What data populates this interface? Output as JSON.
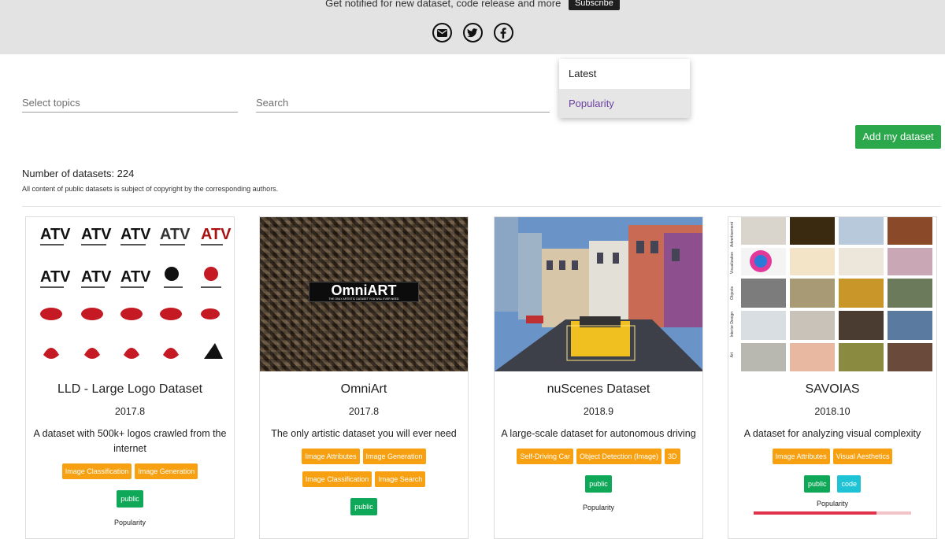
{
  "header": {
    "notify_text": "Get notified for new dataset, code release and more",
    "subscribe_label": "Subscribe",
    "social": [
      {
        "icon": "mail-icon"
      },
      {
        "icon": "twitter-icon"
      },
      {
        "icon": "facebook-icon"
      }
    ]
  },
  "filters": {
    "topics_placeholder": "Select topics",
    "search_placeholder": "Search"
  },
  "sort": {
    "options": [
      {
        "label": "Latest",
        "selected": false
      },
      {
        "label": "Popularity",
        "selected": true
      }
    ]
  },
  "actions": {
    "add_dataset_label": "Add my dataset"
  },
  "summary": {
    "count_label": "Number of datasets: 224",
    "copyright": "All content of public datasets is subject of copyright by the corresponding authors."
  },
  "cards": [
    {
      "title": "LLD - Large Logo Dataset",
      "year": "2017.8",
      "desc": "A dataset with 500k+ logos crawled from the internet",
      "tags": [
        "Image Classification",
        "Image Generation"
      ],
      "badges": [
        "public"
      ],
      "popularity_label": "Popularity"
    },
    {
      "title": "OmniArt",
      "year": "2017.8",
      "desc": "The only artistic dataset you will ever need",
      "thumb_text": "OmniART",
      "thumb_subtext": "THE ONLY ARTISTIC DATASET YOU WILL EVER NEED",
      "tags": [
        "Image Attributes",
        "Image Generation",
        "Image Classification",
        "Image Search"
      ],
      "badges": [
        "public"
      ]
    },
    {
      "title": "nuScenes Dataset",
      "year": "2018.9",
      "desc": "A large-scale dataset for autonomous driving",
      "tags": [
        "Self-Driving Car",
        "Object Detection (Image)",
        "3D"
      ],
      "badges": [
        "public"
      ],
      "popularity_label": "Popularity"
    },
    {
      "title": "SAVOIAS",
      "year": "2018.10",
      "desc": "A dataset for analyzing visual complexity",
      "tags": [
        "Image Attributes",
        "Visual Aesthetics"
      ],
      "badges": [
        "public",
        "code"
      ],
      "popularity_label": "Popularity",
      "popularity": 0.78,
      "thumb_labels": [
        "Advertisement",
        "Visualization",
        "Objects",
        "Interior Design",
        "Art"
      ]
    }
  ],
  "colors": {
    "tag": "#f7a011",
    "public": "#0fa859",
    "code": "#1ec3d5",
    "add_button": "#2aa84b",
    "popularity_bar": "#e0324b"
  }
}
